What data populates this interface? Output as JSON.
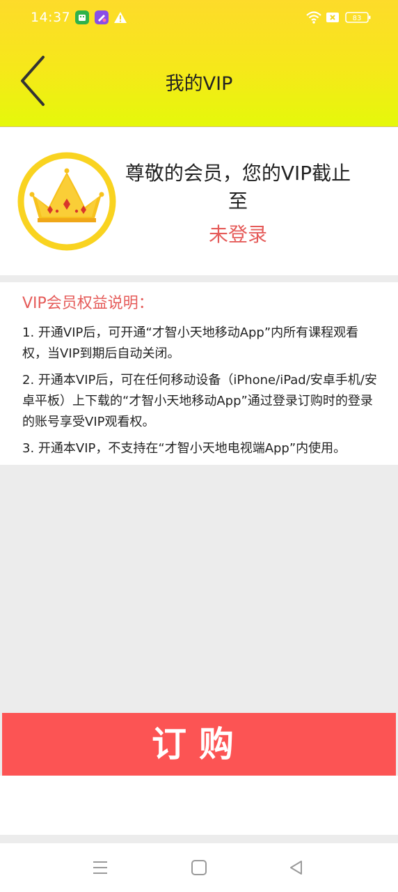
{
  "status_bar": {
    "time": "14:37",
    "battery": "83",
    "icons": [
      "app-icon-green",
      "app-icon-purple",
      "warning-icon",
      "wifi-icon",
      "sim-icon",
      "battery-icon"
    ]
  },
  "header": {
    "title": "我的VIP",
    "back_icon": "chevron-left-icon"
  },
  "member": {
    "badge_icon": "crown-icon",
    "greeting": "尊敬的会员，您的VIP截止至",
    "status": "未登录"
  },
  "benefits": {
    "title": "VIP会员权益说明：",
    "items": [
      "1. 开通VIP后，可开通“才智小天地移动App”内所有课程观看权，当VIP到期后自动关闭。",
      "2. 开通本VIP后，可在任何移动设备（iPhone/iPad/安卓手机/安卓平板）上下载的“才智小天地移动App”通过登录订购时的登录的账号享受VIP观看权。",
      "3. 开通本VIP，不支持在“才智小天地电视端App”内使用。"
    ]
  },
  "order_button": {
    "label": "订购"
  },
  "colors": {
    "header_yellow": "#fddb2a",
    "header_lime": "#e5f80a",
    "accent_red": "#e55b59",
    "order_red": "#fc5454",
    "crown_gold": "#f9d320"
  },
  "nav": {
    "icons": [
      "menu-icon",
      "home-icon",
      "back-icon"
    ]
  }
}
